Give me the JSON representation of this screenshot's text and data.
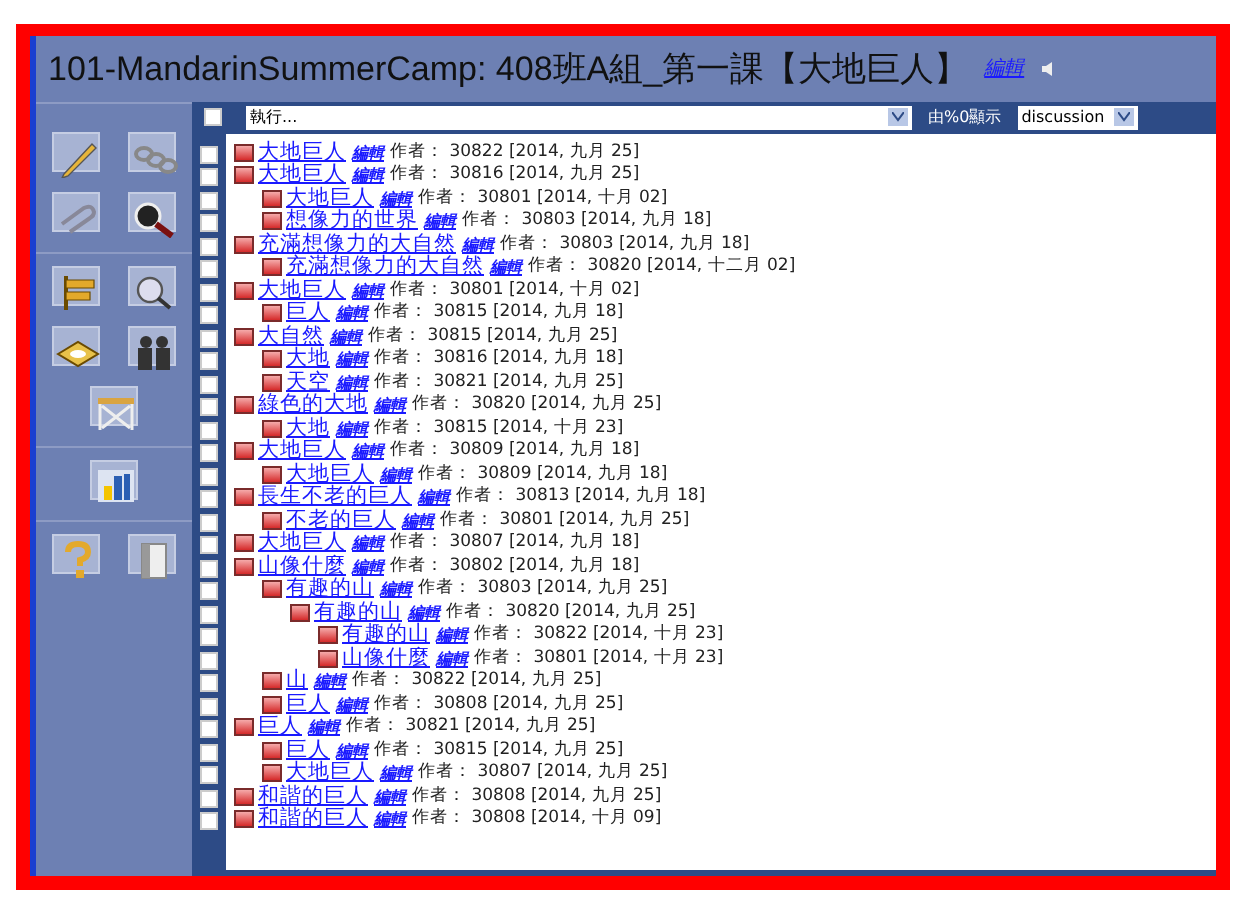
{
  "header": {
    "title": "101-MandarinSummerCamp: 408班A組_第一課【大地巨人】",
    "edit_link": "編輯"
  },
  "toolbar": {
    "select_all_checked": false,
    "action_select": "執行...",
    "display_label": "由%0顯示",
    "view_select": "discussion"
  },
  "posts": [
    {
      "checked": false,
      "title": "大地巨人",
      "edit": "編輯",
      "meta": "作者： 30822 [2014, 九月 25]"
    },
    {
      "checked": false,
      "title": "大地巨人",
      "edit": "編輯",
      "meta": "作者： 30816 [2014, 九月 25]",
      "children": [
        {
          "checked": false,
          "title": "大地巨人",
          "edit": "編輯",
          "meta": "作者： 30801 [2014, 十月 02]"
        },
        {
          "checked": false,
          "title": "想像力的世界",
          "edit": "編輯",
          "meta": "作者： 30803 [2014, 九月 18]"
        }
      ]
    },
    {
      "checked": false,
      "title": "充滿想像力的大自然",
      "edit": "編輯",
      "meta": "作者： 30803 [2014, 九月 18]",
      "children": [
        {
          "checked": false,
          "title": "充滿想像力的大自然",
          "edit": "編輯",
          "meta": "作者： 30820 [2014, 十二月 02]"
        }
      ]
    },
    {
      "checked": false,
      "title": "大地巨人",
      "edit": "編輯",
      "meta": "作者： 30801 [2014, 十月 02]",
      "children": [
        {
          "checked": false,
          "title": "巨人",
          "edit": "編輯",
          "meta": "作者： 30815 [2014, 九月 18]"
        }
      ]
    },
    {
      "checked": false,
      "title": "大自然",
      "edit": "編輯",
      "meta": "作者： 30815 [2014, 九月 25]",
      "children": [
        {
          "checked": false,
          "title": "大地",
          "edit": "編輯",
          "meta": "作者： 30816 [2014, 九月 18]"
        },
        {
          "checked": false,
          "title": "天空",
          "edit": "編輯",
          "meta": "作者： 30821 [2014, 九月 25]"
        }
      ]
    },
    {
      "checked": false,
      "title": "綠色的大地",
      "edit": "編輯",
      "meta": "作者： 30820 [2014, 九月 25]",
      "children": [
        {
          "checked": false,
          "title": "大地",
          "edit": "編輯",
          "meta": "作者： 30815 [2014, 十月 23]"
        }
      ]
    },
    {
      "checked": false,
      "title": "大地巨人",
      "edit": "編輯",
      "meta": "作者： 30809 [2014, 九月 18]",
      "children": [
        {
          "checked": false,
          "title": "大地巨人",
          "edit": "編輯",
          "meta": "作者： 30809 [2014, 九月 18]"
        }
      ]
    },
    {
      "checked": false,
      "title": "長生不老的巨人",
      "edit": "編輯",
      "meta": "作者： 30813 [2014, 九月 18]",
      "children": [
        {
          "checked": false,
          "title": "不老的巨人",
          "edit": "編輯",
          "meta": "作者： 30801 [2014, 九月 25]"
        }
      ]
    },
    {
      "checked": false,
      "title": "大地巨人",
      "edit": "編輯",
      "meta": "作者： 30807 [2014, 九月 18]"
    },
    {
      "checked": false,
      "title": "山像什麼",
      "edit": "編輯",
      "meta": "作者： 30802 [2014, 九月 18]",
      "children": [
        {
          "checked": false,
          "title": "有趣的山",
          "edit": "編輯",
          "meta": "作者： 30803 [2014, 九月 25]",
          "children": [
            {
              "checked": false,
              "title": "有趣的山",
              "edit": "編輯",
              "meta": "作者： 30820 [2014, 九月 25]",
              "children": [
                {
                  "checked": false,
                  "title": "有趣的山",
                  "edit": "編輯",
                  "meta": "作者： 30822 [2014, 十月 23]"
                },
                {
                  "checked": false,
                  "title": "山像什麼",
                  "edit": "編輯",
                  "meta": "作者： 30801 [2014, 十月 23]"
                }
              ]
            }
          ]
        },
        {
          "checked": false,
          "title": "山",
          "edit": "編輯",
          "meta": "作者： 30822 [2014, 九月 25]"
        },
        {
          "checked": false,
          "title": "巨人",
          "edit": "編輯",
          "meta": "作者： 30808 [2014, 九月 25]"
        }
      ]
    },
    {
      "checked": false,
      "title": "巨人",
      "edit": "編輯",
      "meta": "作者： 30821 [2014, 九月 25]",
      "children": [
        {
          "checked": false,
          "title": "巨人",
          "edit": "編輯",
          "meta": "作者： 30815 [2014, 九月 25]"
        },
        {
          "checked": false,
          "title": "大地巨人",
          "edit": "編輯",
          "meta": "作者： 30807 [2014, 九月 25]"
        }
      ]
    },
    {
      "checked": false,
      "title": "和諧的巨人",
      "edit": "編輯",
      "meta": "作者： 30808 [2014, 九月 25]"
    },
    {
      "checked": false,
      "title": "和諧的巨人",
      "edit": "編輯",
      "meta": "作者： 30808 [2014, 十月 09]"
    }
  ]
}
